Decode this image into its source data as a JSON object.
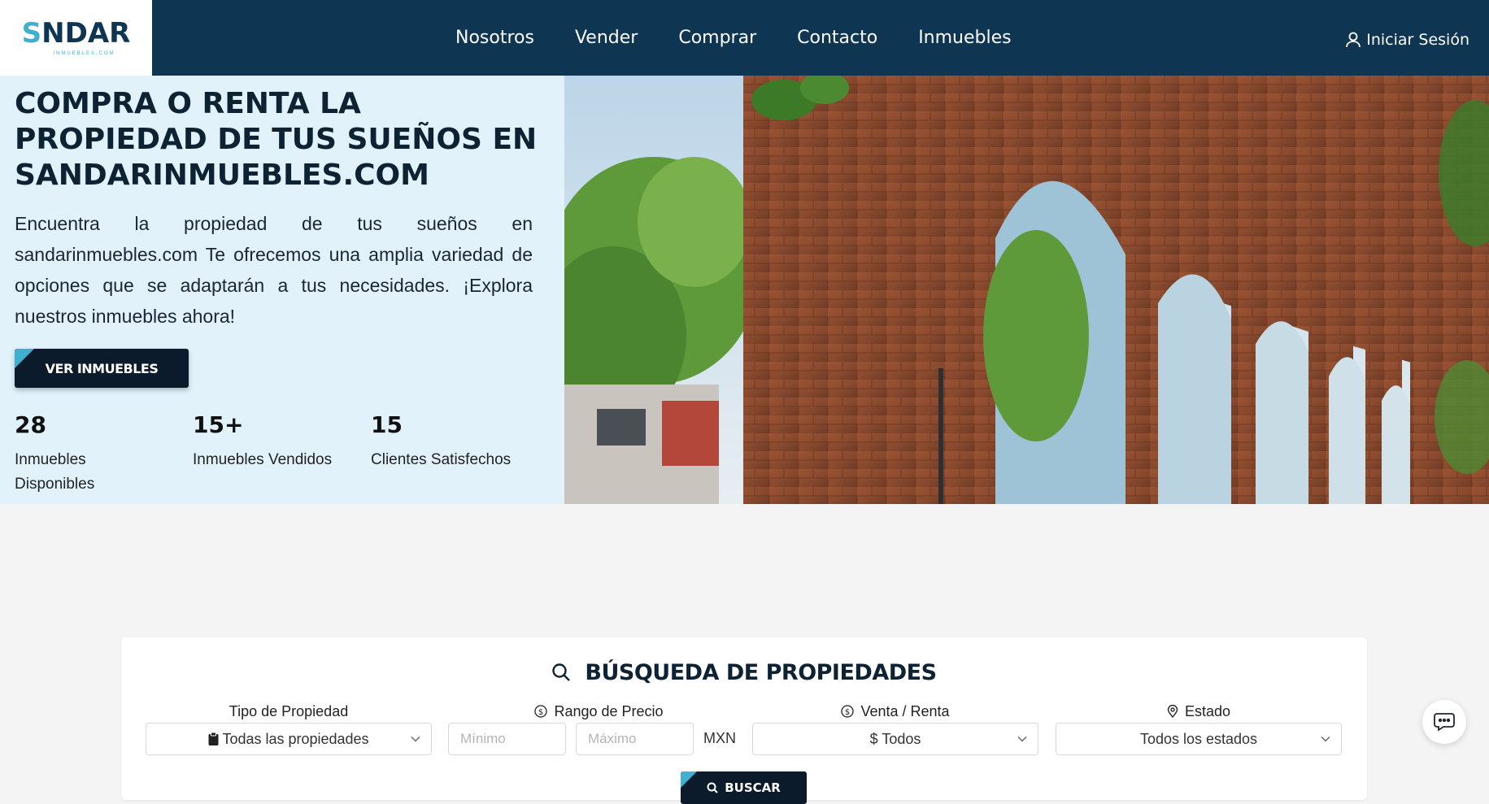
{
  "header": {
    "logo_text": "SNDAR",
    "logo_sub": "INMUEBLES.COM",
    "nav": [
      "Nosotros",
      "Vender",
      "Comprar",
      "Contacto",
      "Inmuebles"
    ],
    "login_label": "Iniciar Sesión"
  },
  "hero": {
    "title": "Compra o renta la propiedad de tus sueños en sandarinmuebles.com",
    "description": "Encuentra la propiedad de tus sueños en sandarinmuebles.com Te ofrecemos una amplia variedad de opciones que se adaptarán a tus necesidades. ¡Explora nuestros inmuebles ahora!",
    "cta_label": "VER INMUEBLES",
    "stats": [
      {
        "value": "28",
        "label": "Inmuebles Disponibles"
      },
      {
        "value": "15+",
        "label": "Inmuebles Vendidos"
      },
      {
        "value": "15",
        "label": "Clientes Satisfechos"
      }
    ]
  },
  "search": {
    "title": "BÚSQUEDA DE PROPIEDADES",
    "property_type_label": "Tipo de Propiedad",
    "property_type_value": "Todas las propiedades",
    "price_label": "Rango de Precio",
    "price_min_placeholder": "Mínimo",
    "price_max_placeholder": "Máximo",
    "currency": "MXN",
    "sale_rent_label": "Venta / Renta",
    "sale_rent_value": "$ Todos",
    "state_label": "Estado",
    "state_value": "Todos los estados",
    "search_button": "BUSCAR"
  },
  "colors": {
    "header_bg": "#0e3552",
    "accent": "#3fb1cf",
    "hero_bg": "#e1f2fb",
    "button_bg": "#0b1b2b"
  }
}
